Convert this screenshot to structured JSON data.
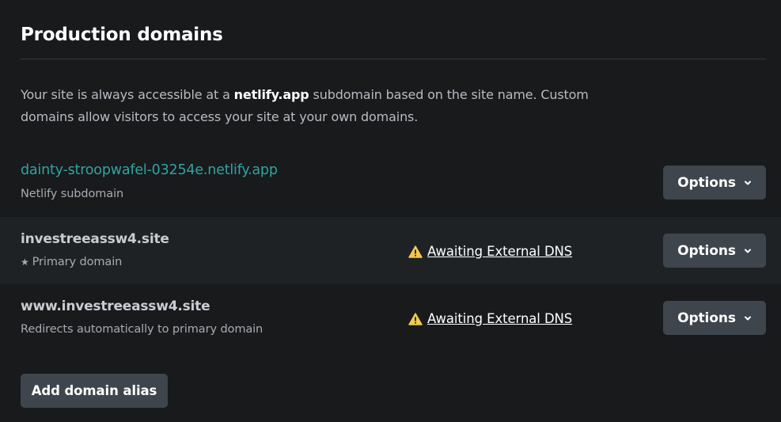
{
  "section": {
    "title": "Production domains",
    "description_pre": "Your site is always accessible at a ",
    "description_bold": "netlify.app",
    "description_post": " subdomain based on the site name. Custom domains allow visitors to access your site at your own domains."
  },
  "domains": [
    {
      "name": "dainty-stroopwafel-03254e.netlify.app",
      "subtitle": "Netlify subdomain",
      "status": "",
      "options_label": "Options"
    },
    {
      "name": "investreeassw4.site",
      "subtitle": "Primary domain",
      "status": "Awaiting External DNS",
      "options_label": "Options"
    },
    {
      "name": "www.investreeassw4.site",
      "subtitle": "Redirects automatically to primary domain",
      "status": "Awaiting External DNS",
      "options_label": "Options"
    }
  ],
  "add_alias_label": "Add domain alias",
  "colors": {
    "background": "#181a1c",
    "alt_row": "#1f2225",
    "link_teal": "#32a2a2",
    "button": "#3f454c",
    "warning": "#f2c94c"
  },
  "icons": {
    "star": "star-icon",
    "warning": "warning-icon",
    "chevron": "chevron-down-icon"
  }
}
